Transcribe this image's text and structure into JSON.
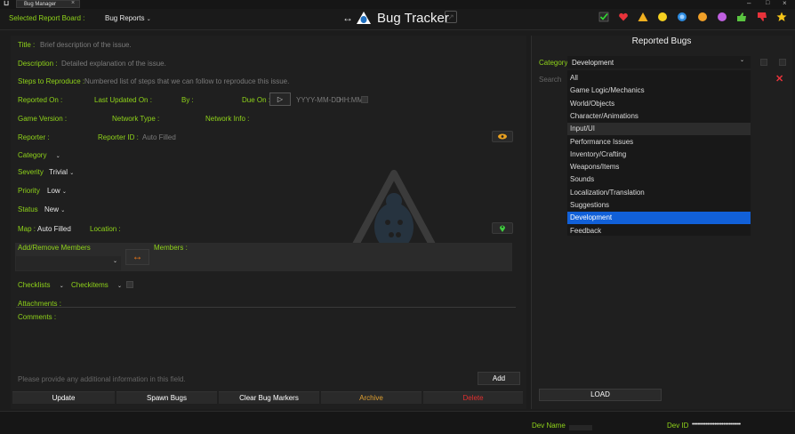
{
  "window": {
    "tab_title": "Bug Manager",
    "tab_close": "×",
    "minimize": "–",
    "maximize": "□",
    "close": "×"
  },
  "header": {
    "board_label": "Selected Report Board :",
    "board_value": "Bug Reports",
    "app_title": "Bug Tracker",
    "toolbar_icons": [
      "checkmark-icon",
      "heart-icon",
      "warning-icon",
      "smiley-yellow-icon",
      "smiley-blue-icon",
      "smiley-orange-icon",
      "smiley-purple-icon",
      "thumbs-up-icon",
      "thumbs-down-icon",
      "star-icon"
    ]
  },
  "form": {
    "title_label": "Title :",
    "title_placeholder": "Brief description of the issue.",
    "description_label": "Description :",
    "description_placeholder": "Detailed explanation of the issue.",
    "steps_label": "Steps to Reproduce :",
    "steps_placeholder": "Numbered list of steps that we can follow to reproduce this issue.",
    "reported_on_label": "Reported On :",
    "last_updated_label": "Last Updated On :",
    "by_label": "By :",
    "due_on_label": "Due On :",
    "due_date_placeholder": "YYYY-MM-DD",
    "due_time_placeholder": "HH:MM",
    "game_version_label": "Game Version :",
    "network_type_label": "Network Type :",
    "network_info_label": "Network Info :",
    "reporter_label": "Reporter :",
    "reporter_id_label": "Reporter ID :",
    "reporter_id_value": "Auto Filled",
    "category_label": "Category",
    "severity_label": "Severity",
    "severity_value": "Trivial",
    "priority_label": "Priority",
    "priority_value": "Low",
    "status_label": "Status",
    "status_value": "New",
    "map_label": "Map :",
    "map_value": "Auto Filled",
    "location_label": "Location :",
    "add_remove_members_label": "Add/Remove Members",
    "members_label": "Members :",
    "checklists_label": "Checklists",
    "checkitems_label": "Checkitems",
    "attachments_label": "Attachments :",
    "comments_label": "Comments :",
    "comment_placeholder": "Please provide any additional information in this field.",
    "add_button": "Add"
  },
  "actions": {
    "update": "Update",
    "spawn_bugs": "Spawn Bugs",
    "clear_markers": "Clear Bug Markers",
    "archive": "Archive",
    "delete": "Delete"
  },
  "reported": {
    "heading": "Reported Bugs",
    "category_label": "Category",
    "category_value": "Development",
    "search_placeholder": "Search",
    "load_button": "LOAD",
    "dropdown_options": [
      "All",
      "Game Logic/Mechanics",
      "World/Objects",
      "Character/Animations",
      "Input/UI",
      "Performance Issues",
      "Inventory/Crafting",
      "Weapons/Items",
      "Sounds",
      "Localization/Translation",
      "Suggestions",
      "Development",
      "Feedback"
    ],
    "selected_option": "Development",
    "hovered_option": "Input/UI"
  },
  "footer": {
    "dev_name_label": "Dev Name",
    "dev_id_label": "Dev ID",
    "dev_id_value": "••••••••••••••••••••••••••••"
  },
  "colors": {
    "accent_green": "#8fd31a",
    "archive": "#e0a030",
    "delete": "#e03030",
    "selection": "#1160d8",
    "orange": "#f07818"
  }
}
